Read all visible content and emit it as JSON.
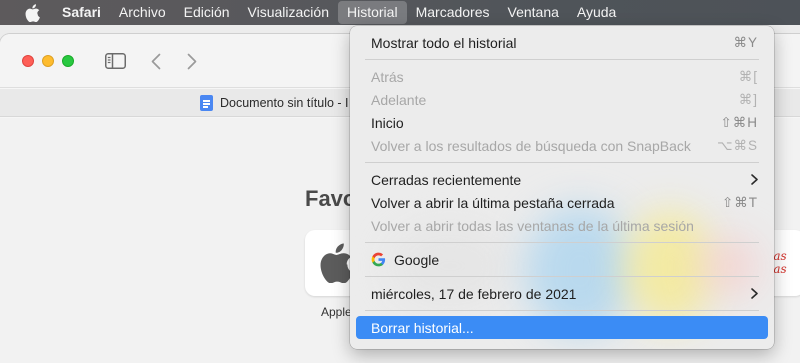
{
  "menubar": {
    "apple_icon": "apple-logo-icon",
    "app_name": "Safari",
    "menus": [
      "Archivo",
      "Edición",
      "Visualización",
      "Historial",
      "Marcadores",
      "Ventana",
      "Ayuda"
    ],
    "active_menu": "Historial"
  },
  "window": {
    "traffic_lights": {
      "close": "#fe5f57",
      "minimize": "#febc2e",
      "zoom": "#28c840"
    },
    "toolbar_icons": [
      "sidebar-icon",
      "back-chevron-icon",
      "forward-chevron-icon"
    ],
    "tab": {
      "title": "Documento sin título - I",
      "icon": "google-docs-icon"
    },
    "favorites": {
      "title": "Favo",
      "tiles": [
        {
          "label": "Apple",
          "icon": "apple-logo-icon"
        },
        {
          "text": "as\nas"
        }
      ],
      "apple_label": "Apple"
    }
  },
  "history_menu": {
    "items": [
      {
        "label": "Mostrar todo el historial",
        "shortcut": "⌘Y",
        "enabled": true
      },
      {
        "label": "Atrás",
        "shortcut": "⌘[",
        "enabled": false
      },
      {
        "label": "Adelante",
        "shortcut": "⌘]",
        "enabled": false
      },
      {
        "label": "Inicio",
        "shortcut": "⇧⌘H",
        "enabled": true
      },
      {
        "label": "Volver a los resultados de búsqueda con SnapBack",
        "shortcut": "⌥⌘S",
        "enabled": false
      },
      {
        "label": "Cerradas recientemente",
        "submenu": true,
        "enabled": true
      },
      {
        "label": "Volver a abrir la última pestaña cerrada",
        "shortcut": "⇧⌘T",
        "enabled": true
      },
      {
        "label": "Volver a abrir todas las ventanas de la última sesión",
        "enabled": false
      },
      {
        "label": "Google",
        "icon": "google-g-icon",
        "enabled": true
      },
      {
        "label": "miércoles, 17 de febrero de 2021",
        "submenu": true,
        "enabled": true
      },
      {
        "label": "Borrar historial...",
        "enabled": true,
        "highlighted": true
      }
    ]
  },
  "colors": {
    "menu_highlight": "#3b8cf5",
    "menubar_bg": "#55575b"
  }
}
